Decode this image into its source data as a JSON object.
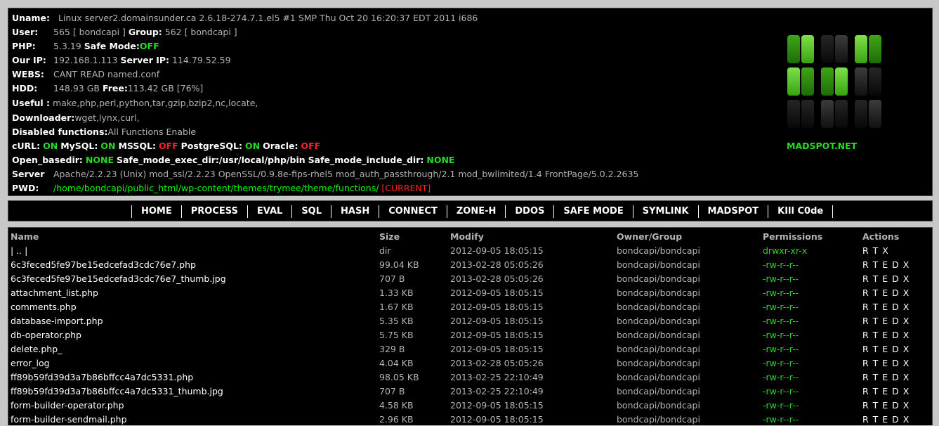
{
  "info": {
    "uname_label": "Uname:",
    "uname": "Linux server2.domainsunder.ca 2.6.18-274.7.1.el5 #1 SMP Thu Oct 20 16:20:37 EDT 2011 i686",
    "user_label": "User:",
    "user": "565 [ bondcapi ]",
    "group_label": "Group:",
    "group": "562 [ bondcapi ]",
    "php_label": "PHP:",
    "php": "5.3.19",
    "safe_mode_label": "Safe Mode:",
    "safe_mode": "OFF",
    "our_ip_label": "Our IP:",
    "our_ip": "192.168.1.113",
    "server_ip_label": "Server IP:",
    "server_ip": "114.79.52.59",
    "webs_label": "WEBS:",
    "webs": "CANT READ named.conf",
    "hdd_label": "HDD:",
    "hdd": "148.93 GB",
    "free_label": "Free:",
    "free": "113.42 GB [76%]",
    "useful_label": "Useful :",
    "useful": "make,php,perl,python,tar,gzip,bzip2,nc,locate,",
    "downloader_label": "Downloader:",
    "downloader": "wget,lynx,curl,",
    "disabled_label": "Disabled functions:",
    "disabled": "All Functions Enable",
    "curl_label": "cURL:",
    "curl": "ON",
    "mysql_label": "MySQL:",
    "mysql": "ON",
    "mssql_label": "MSSQL:",
    "mssql": "OFF",
    "pgsql_label": "PostgreSQL:",
    "pgsql": "ON",
    "oracle_label": "Oracle:",
    "oracle": "OFF",
    "basedir_label": "Open_basedir:",
    "basedir": "NONE",
    "exec_dir_label": "Safe_mode_exec_dir:/usr/local/php/bin",
    "include_dir_label": "Safe_mode_include_dir:",
    "include_dir": "NONE",
    "server_label": "Server",
    "server": "Apache/2.2.23 (Unix) mod_ssl/2.2.23 OpenSSL/0.9.8e-fips-rhel5 mod_auth_passthrough/2.1 mod_bwlimited/1.4 FrontPage/5.0.2.2635",
    "pwd_label": "PWD:",
    "pwd": "/home/bondcapi/public_html/wp-content/themes/trymee/theme/functions/",
    "pwd_current": "[CURRENT]"
  },
  "logo": {
    "text": "MADSPOT.NET",
    "icon": "madspot-cube-logo"
  },
  "menu": [
    "HOME",
    "PROCESS",
    "EVAL",
    "SQL",
    "HASH",
    "CONNECT",
    "ZONE-H",
    "DDOS",
    "SAFE MODE",
    "SYMLINK",
    "MADSPOT",
    "KIll C0de"
  ],
  "table": {
    "headers": [
      "Name",
      "Size",
      "Modify",
      "Owner/Group",
      "Permissions",
      "Actions"
    ],
    "rows": [
      {
        "name": "| .. |",
        "size": "dir",
        "modify": "2012-09-05 18:05:15",
        "owner": "bondcapi/bondcapi",
        "perm": "drwxr-xr-x",
        "actions": "R T X"
      },
      {
        "name": "6c3feced5fe97be15edcefad3cdc76e7.php",
        "size": "99.04 KB",
        "modify": "2013-02-28 05:05:26",
        "owner": "bondcapi/bondcapi",
        "perm": "-rw-r--r--",
        "actions": "R T E D X"
      },
      {
        "name": "6c3feced5fe97be15edcefad3cdc76e7_thumb.jpg",
        "size": "707 B",
        "modify": "2013-02-28 05:05:26",
        "owner": "bondcapi/bondcapi",
        "perm": "-rw-r--r--",
        "actions": "R T E D X"
      },
      {
        "name": "attachment_list.php",
        "size": "1.33 KB",
        "modify": "2012-09-05 18:05:15",
        "owner": "bondcapi/bondcapi",
        "perm": "-rw-r--r--",
        "actions": "R T E D X"
      },
      {
        "name": "comments.php",
        "size": "1.67 KB",
        "modify": "2012-09-05 18:05:15",
        "owner": "bondcapi/bondcapi",
        "perm": "-rw-r--r--",
        "actions": "R T E D X"
      },
      {
        "name": "database-import.php",
        "size": "5.35 KB",
        "modify": "2012-09-05 18:05:15",
        "owner": "bondcapi/bondcapi",
        "perm": "-rw-r--r--",
        "actions": "R T E D X"
      },
      {
        "name": "db-operator.php",
        "size": "5.75 KB",
        "modify": "2012-09-05 18:05:15",
        "owner": "bondcapi/bondcapi",
        "perm": "-rw-r--r--",
        "actions": "R T E D X"
      },
      {
        "name": "delete.php_",
        "size": "329 B",
        "modify": "2012-09-05 18:05:15",
        "owner": "bondcapi/bondcapi",
        "perm": "-rw-r--r--",
        "actions": "R T E D X"
      },
      {
        "name": "error_log",
        "size": "4.04 KB",
        "modify": "2013-02-28 05:05:26",
        "owner": "bondcapi/bondcapi",
        "perm": "-rw-r--r--",
        "actions": "R T E D X"
      },
      {
        "name": "ff89b59fd39d3a7b86bffcc4a7dc5331.php",
        "size": "98.05 KB",
        "modify": "2013-02-25 22:10:49",
        "owner": "bondcapi/bondcapi",
        "perm": "-rw-r--r--",
        "actions": "R T E D X"
      },
      {
        "name": "ff89b59fd39d3a7b86bffcc4a7dc5331_thumb.jpg",
        "size": "707 B",
        "modify": "2013-02-25 22:10:49",
        "owner": "bondcapi/bondcapi",
        "perm": "-rw-r--r--",
        "actions": "R T E D X"
      },
      {
        "name": "form-builder-operator.php",
        "size": "4.58 KB",
        "modify": "2012-09-05 18:05:15",
        "owner": "bondcapi/bondcapi",
        "perm": "-rw-r--r--",
        "actions": "R T E D X"
      },
      {
        "name": "form-builder-sendmail.php",
        "size": "2.96 KB",
        "modify": "2012-09-05 18:05:15",
        "owner": "bondcapi/bondcapi",
        "perm": "-rw-r--r--",
        "actions": "R T E D X"
      }
    ]
  },
  "colors": {
    "on": "#22dd22",
    "off": "#ff2222",
    "muted": "#b4b4b4",
    "bg": "#000000",
    "frame": "#c8c8c8"
  }
}
